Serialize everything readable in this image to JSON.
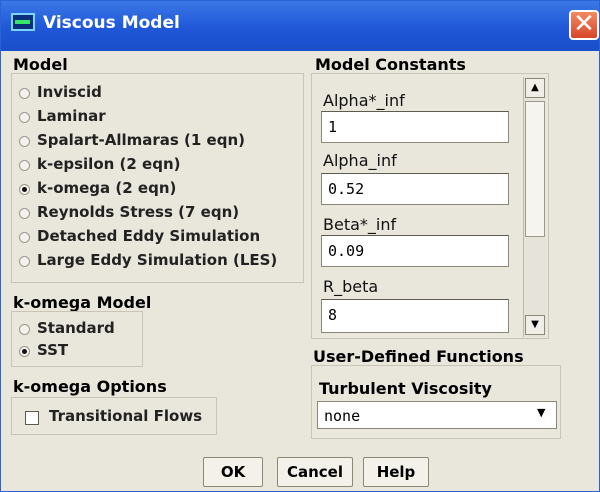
{
  "window": {
    "title": "Viscous Model",
    "close_glyph": "✕"
  },
  "model": {
    "heading": "Model",
    "options": [
      {
        "label": "Inviscid",
        "selected": false
      },
      {
        "label": "Laminar",
        "selected": false
      },
      {
        "label": "Spalart-Allmaras (1 eqn)",
        "selected": false
      },
      {
        "label": "k-epsilon (2 eqn)",
        "selected": false
      },
      {
        "label": "k-omega (2 eqn)",
        "selected": true
      },
      {
        "label": "Reynolds Stress (7 eqn)",
        "selected": false
      },
      {
        "label": "Detached Eddy Simulation",
        "selected": false
      },
      {
        "label": "Large Eddy Simulation (LES)",
        "selected": false
      }
    ]
  },
  "komega_model": {
    "heading": "k-omega Model",
    "options": [
      {
        "label": "Standard",
        "selected": false
      },
      {
        "label": "SST",
        "selected": true
      }
    ]
  },
  "komega_options": {
    "heading": "k-omega Options",
    "transitional_flows": "Transitional Flows",
    "checked": false
  },
  "constants": {
    "heading": "Model Constants",
    "fields": [
      {
        "label": "Alpha*_inf",
        "value": "1"
      },
      {
        "label": "Alpha_inf",
        "value": "0.52"
      },
      {
        "label": "Beta*_inf",
        "value": "0.09"
      },
      {
        "label": "R_beta",
        "value": "8"
      }
    ]
  },
  "udf": {
    "heading": "User-Defined Functions",
    "turbulent_viscosity_label": "Turbulent Viscosity",
    "turbulent_viscosity_value": "none"
  },
  "buttons": {
    "ok": "OK",
    "cancel": "Cancel",
    "help": "Help"
  }
}
